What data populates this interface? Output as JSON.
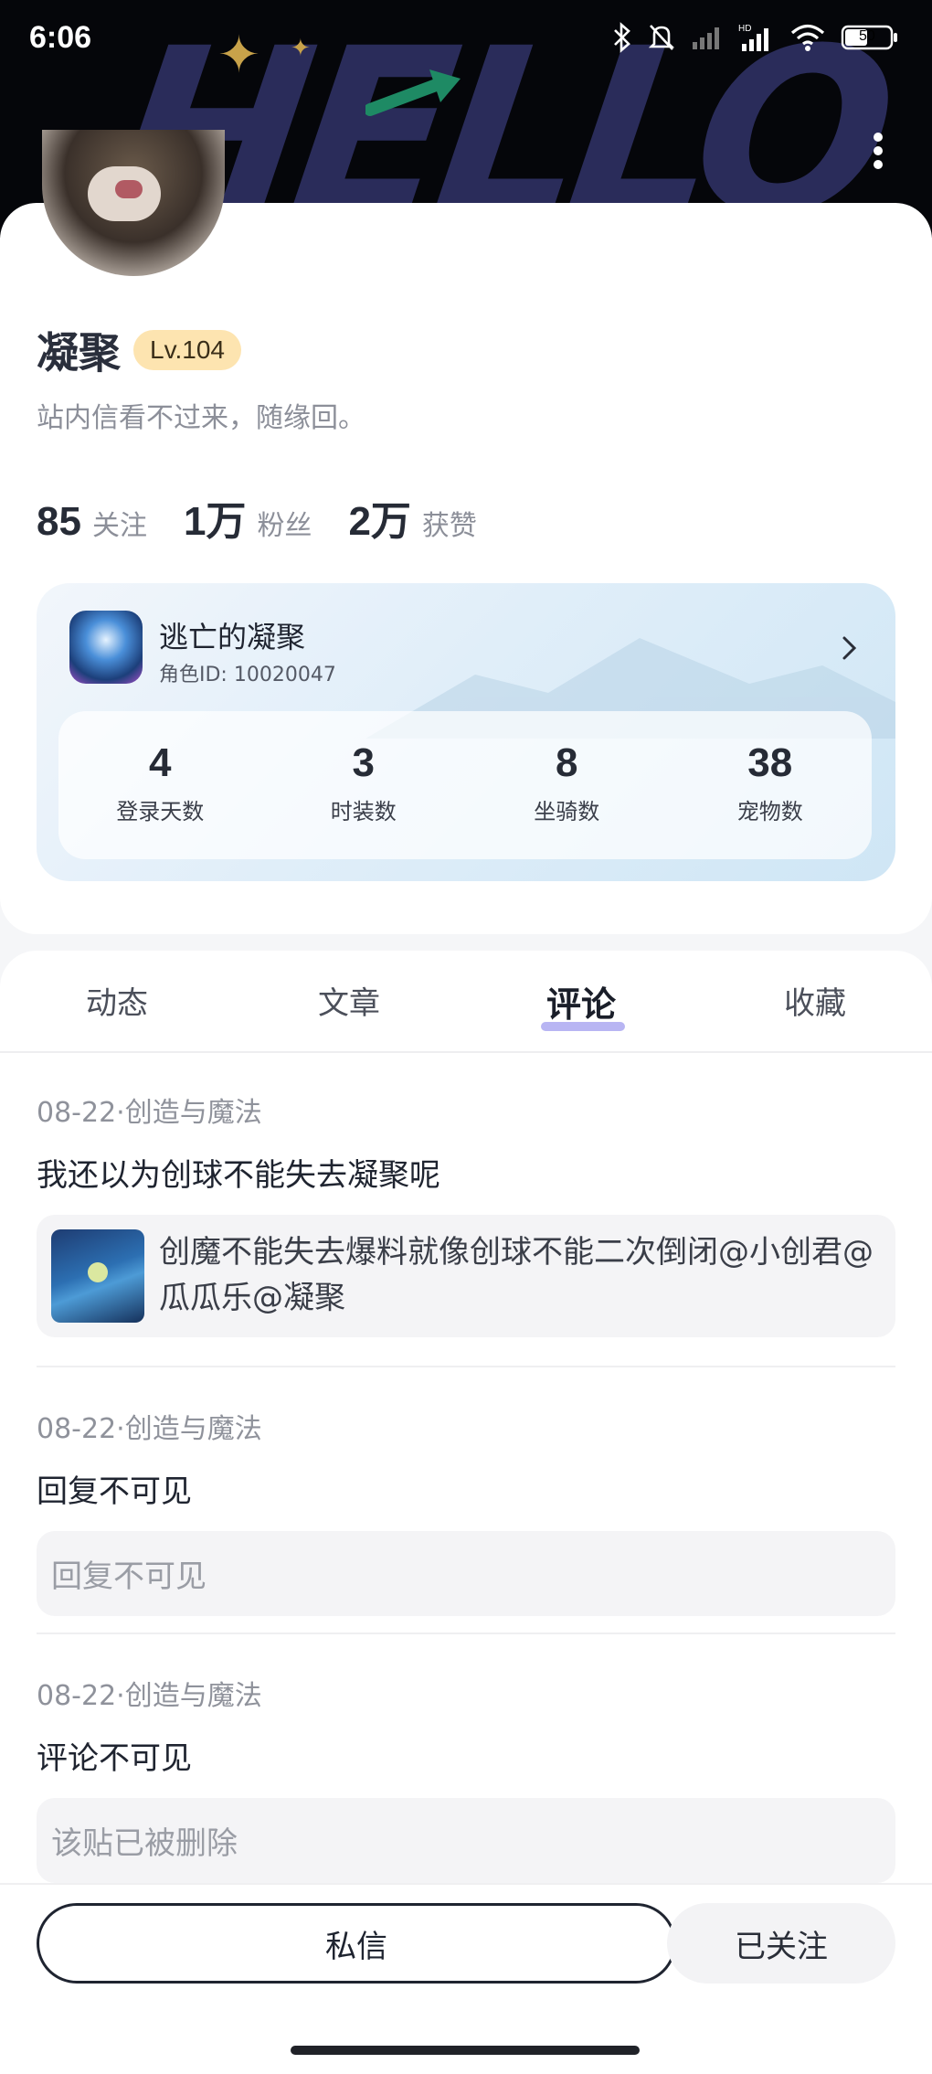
{
  "status_bar": {
    "time": "6:06",
    "battery": "50",
    "icons": [
      "bluetooth-icon",
      "mute-icon",
      "signal-icon",
      "hd-signal-icon",
      "wifi-icon",
      "battery-icon"
    ]
  },
  "header": {
    "background_text": "HELLO"
  },
  "profile": {
    "name": "凝聚",
    "level": "Lv.104",
    "bio": "站内信看不过来，随缘回。",
    "stats": [
      {
        "value": "85",
        "label": "关注"
      },
      {
        "value": "1万",
        "label": "粉丝"
      },
      {
        "value": "2万",
        "label": "获赞"
      }
    ]
  },
  "game_card": {
    "name": "逃亡的凝聚",
    "role_id": "角色ID: 10020047",
    "stats": [
      {
        "value": "4",
        "label": "登录天数"
      },
      {
        "value": "3",
        "label": "时装数"
      },
      {
        "value": "8",
        "label": "坐骑数"
      },
      {
        "value": "38",
        "label": "宠物数"
      }
    ]
  },
  "tabs": [
    {
      "label": "动态",
      "active": false
    },
    {
      "label": "文章",
      "active": false
    },
    {
      "label": "评论",
      "active": true
    },
    {
      "label": "收藏",
      "active": false
    }
  ],
  "comments": [
    {
      "meta": "08-22·创造与魔法",
      "text": "我还以为创球不能失去凝聚呢",
      "quote": "创魔不能失去爆料就像创球不能二次倒闭@小创君@瓜瓜乐@凝聚"
    },
    {
      "meta": "08-22·创造与魔法",
      "text": "回复不可见",
      "quote": "回复不可见"
    },
    {
      "meta": "08-22·创造与魔法",
      "text": "评论不可见",
      "quote": "该贴已被删除"
    }
  ],
  "actions": {
    "message": "私信",
    "follow": "已关注"
  },
  "colors": {
    "accent_underline": "#b8b5f3",
    "level_badge": "#fde4b0"
  }
}
